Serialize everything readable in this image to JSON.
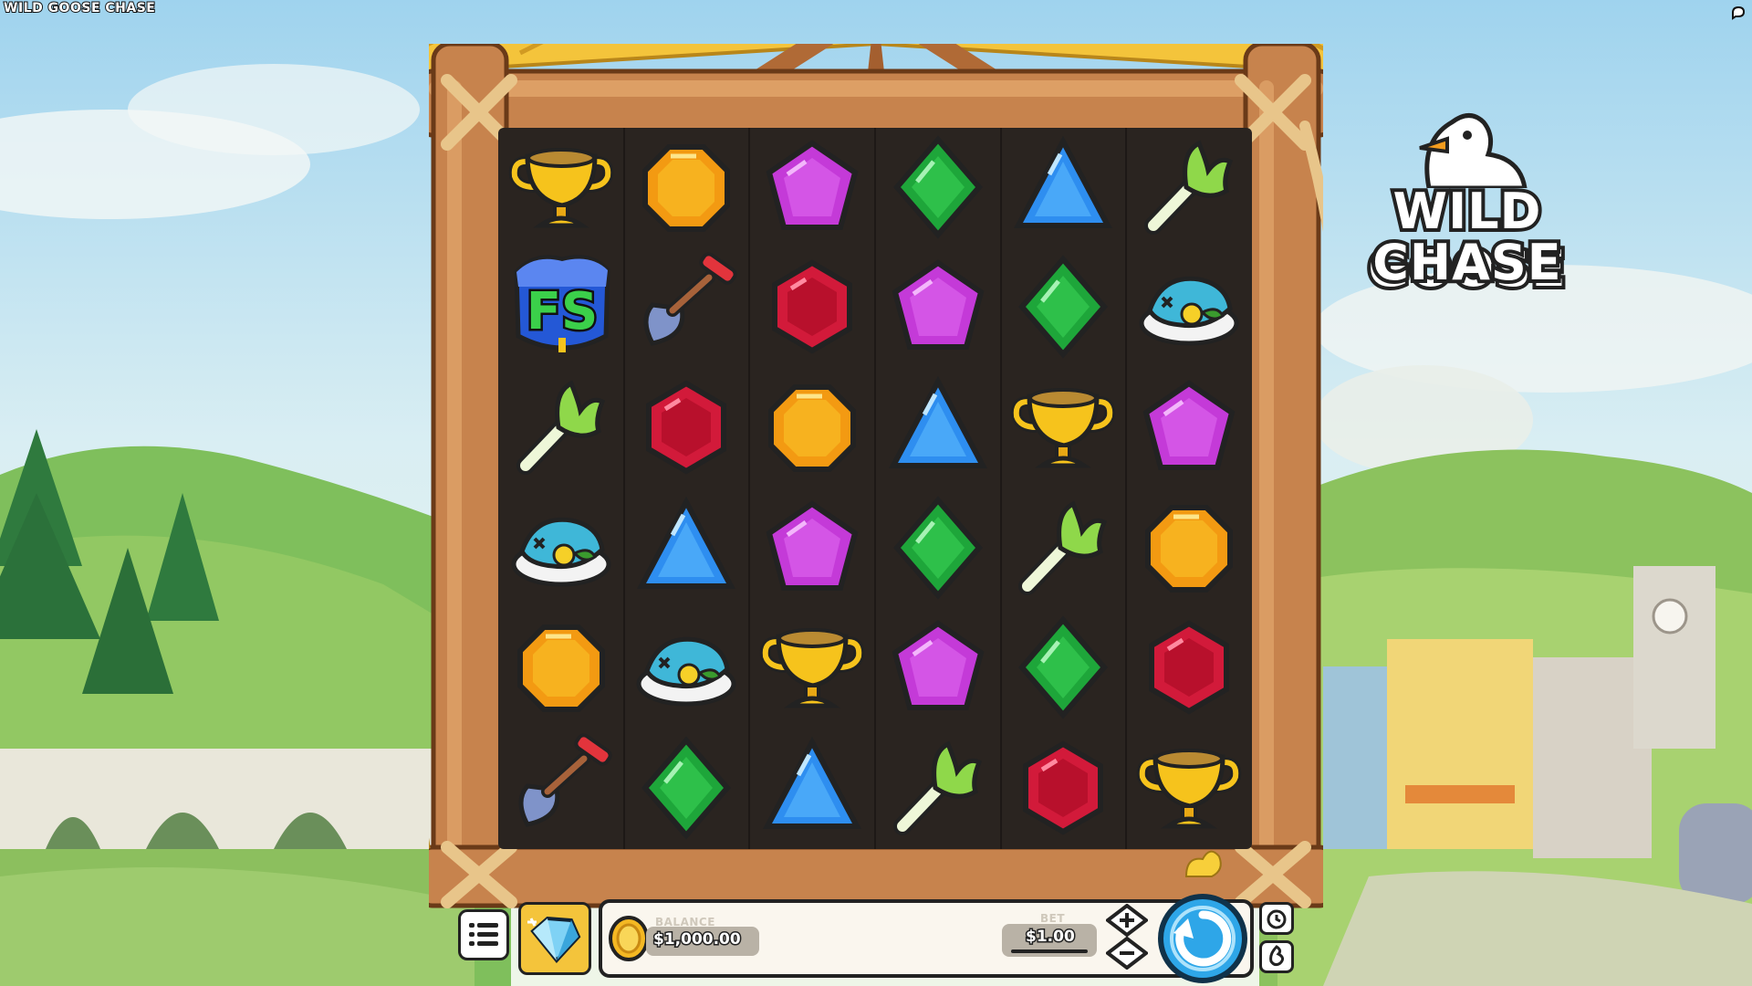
{
  "game": {
    "title_small": "WILD GOOSE CHASE",
    "logo_line1": "WILD GOOSE",
    "logo_line2": "CHASE"
  },
  "colors": {
    "wood": "#c7834d",
    "wood_dark": "#8a4f26",
    "wood_light": "#e2a66c",
    "straw": "#f4c43b",
    "reel_bg": "#2a2420",
    "accent_blue": "#2ea6e8"
  },
  "reels": [
    [
      "trophy-icon",
      "free-spins-scatter-icon",
      "leek-icon",
      "fish-plate-icon",
      "orange-octagon-gem-icon",
      "shovel-icon"
    ],
    [
      "orange-octagon-gem-icon",
      "shovel-icon",
      "red-hexagon-gem-icon",
      "blue-triangle-gem-icon",
      "fish-plate-icon",
      "green-diamond-gem-icon"
    ],
    [
      "purple-pentagon-gem-icon",
      "red-hexagon-gem-icon",
      "orange-octagon-gem-icon",
      "purple-pentagon-gem-icon",
      "trophy-icon",
      "blue-triangle-gem-icon"
    ],
    [
      "green-diamond-gem-icon",
      "purple-pentagon-gem-icon",
      "blue-triangle-gem-icon",
      "green-diamond-gem-icon",
      "purple-pentagon-gem-icon",
      "leek-icon"
    ],
    [
      "blue-triangle-gem-icon",
      "green-diamond-gem-icon",
      "trophy-icon",
      "leek-icon",
      "green-diamond-gem-icon",
      "red-hexagon-gem-icon"
    ],
    [
      "leek-icon",
      "fish-plate-icon",
      "purple-pentagon-gem-icon",
      "orange-octagon-gem-icon",
      "red-hexagon-gem-icon",
      "trophy-icon"
    ]
  ],
  "scatter_label": "FS",
  "bottom_bar": {
    "menu_icon": "menu-list-icon",
    "gem_shop_icon": "diamond-icon",
    "balance_label": "BALANCE",
    "balance_value": "$1,000.00",
    "bet_label": "BET",
    "bet_value": "$1.00",
    "bet_plus_icon": "plus-icon",
    "bet_minus_icon": "minus-icon",
    "spin_icon": "spin-arrow-icon",
    "autoplay_icon": "autoplay-icon",
    "turbo_icon": "turbo-icon"
  }
}
